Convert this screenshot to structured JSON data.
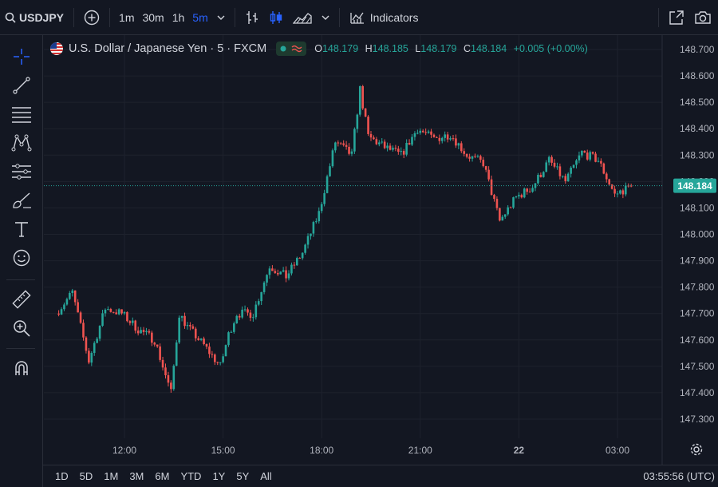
{
  "toolbar": {
    "symbol": "USDJPY",
    "timeframes": [
      "1m",
      "30m",
      "1h",
      "5m"
    ],
    "active_timeframe": "5m",
    "indicators_label": "Indicators"
  },
  "legend": {
    "title": "U.S. Dollar / Japanese Yen · 5 · FXCM",
    "open_key": "O",
    "open": "148.179",
    "high_key": "H",
    "high": "148.185",
    "low_key": "L",
    "low": "148.179",
    "close_key": "C",
    "close": "148.184",
    "change": "+0.005 (+0.00%)"
  },
  "bottom": {
    "ranges": [
      "1D",
      "5D",
      "1M",
      "3M",
      "6M",
      "YTD",
      "1Y",
      "5Y",
      "All"
    ],
    "clock": "03:55:56 (UTC)"
  },
  "colors": {
    "up": "#26a69a",
    "down": "#ef5350",
    "bg": "#131722",
    "grid": "#1e222d",
    "accent": "#2962ff"
  },
  "chart_data": {
    "type": "candlestick",
    "symbol": "USDJPY",
    "interval": "5",
    "price_axis_labels": [
      "148.700",
      "148.600",
      "148.500",
      "148.400",
      "148.300",
      "148.200",
      "148.100",
      "148.000",
      "147.900",
      "147.800",
      "147.700",
      "147.600",
      "147.500",
      "147.400",
      "147.300"
    ],
    "ylim": [
      147.25,
      148.75
    ],
    "time_axis_labels": [
      "12:00",
      "15:00",
      "18:00",
      "21:00",
      "22",
      "03:00"
    ],
    "last_price": "148.184",
    "close_path": [
      {
        "t": "10:00",
        "v": 147.7
      },
      {
        "t": "10:30",
        "v": 147.78
      },
      {
        "t": "11:00",
        "v": 147.52
      },
      {
        "t": "11:30",
        "v": 147.72
      },
      {
        "t": "12:00",
        "v": 147.7
      },
      {
        "t": "12:30",
        "v": 147.64
      },
      {
        "t": "13:00",
        "v": 147.6
      },
      {
        "t": "13:30",
        "v": 147.4
      },
      {
        "t": "13:45",
        "v": 147.7
      },
      {
        "t": "14:00",
        "v": 147.65
      },
      {
        "t": "14:30",
        "v": 147.58
      },
      {
        "t": "15:00",
        "v": 147.5
      },
      {
        "t": "15:15",
        "v": 147.62
      },
      {
        "t": "15:30",
        "v": 147.7
      },
      {
        "t": "16:00",
        "v": 147.7
      },
      {
        "t": "16:30",
        "v": 147.88
      },
      {
        "t": "17:00",
        "v": 147.84
      },
      {
        "t": "17:30",
        "v": 147.93
      },
      {
        "t": "18:00",
        "v": 148.08
      },
      {
        "t": "18:30",
        "v": 148.35
      },
      {
        "t": "19:00",
        "v": 148.3
      },
      {
        "t": "19:15",
        "v": 148.55
      },
      {
        "t": "19:30",
        "v": 148.37
      },
      {
        "t": "20:00",
        "v": 148.33
      },
      {
        "t": "20:30",
        "v": 148.3
      },
      {
        "t": "21:00",
        "v": 148.4
      },
      {
        "t": "21:30",
        "v": 148.36
      },
      {
        "t": "22:00",
        "v": 148.38
      },
      {
        "t": "22:30",
        "v": 148.3
      },
      {
        "t": "23:00",
        "v": 148.27
      },
      {
        "t": "23:30",
        "v": 148.05
      },
      {
        "t": "00:00",
        "v": 148.14
      },
      {
        "t": "00:30",
        "v": 148.18
      },
      {
        "t": "01:00",
        "v": 148.28
      },
      {
        "t": "01:30",
        "v": 148.2
      },
      {
        "t": "02:00",
        "v": 148.31
      },
      {
        "t": "02:30",
        "v": 148.28
      },
      {
        "t": "03:00",
        "v": 148.15
      },
      {
        "t": "03:30",
        "v": 148.184
      }
    ]
  }
}
